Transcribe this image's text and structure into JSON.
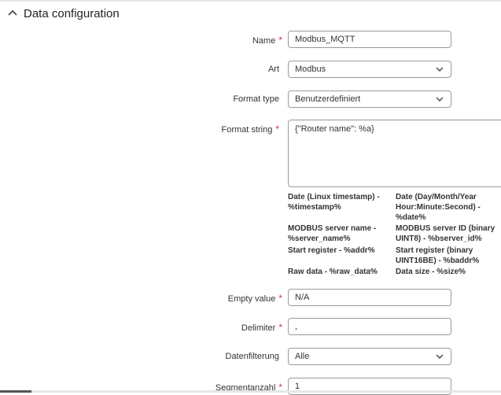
{
  "section": {
    "title": "Data configuration",
    "collapse_icon": "chevron-up-icon"
  },
  "fields": {
    "name": {
      "label": "Name",
      "value": "Modbus_MQTT",
      "required": "*"
    },
    "art": {
      "label": "Art",
      "value": "Modbus"
    },
    "format_type": {
      "label": "Format type",
      "value": "Benutzerdefiniert"
    },
    "format_string": {
      "label": "Format string",
      "value": "{\"Router name\": %a}",
      "required": "*"
    },
    "empty_value": {
      "label": "Empty value",
      "value": "N/A",
      "required": "*"
    },
    "delimiter": {
      "label": "Delimiter",
      "value": ",",
      "required": "*"
    },
    "datenfilterung": {
      "label": "Datenfilterung",
      "value": "Alle"
    },
    "segmentanzahl": {
      "label": "Segmentanzahl",
      "value": "1",
      "required": "*"
    }
  },
  "placeholders": [
    [
      "Date (Linux timestamp) -",
      "%timestamp%"
    ],
    [
      "Date (Day/Month/Year",
      "Hour:Minute:Second) -",
      "%date%"
    ],
    [
      "MODBUS server name -",
      "%server_name%"
    ],
    [
      "MODBUS server ID (binary",
      "UINT8) - %bserver_id%"
    ],
    [
      "Start register - %addr%"
    ],
    [
      "Start register (binary",
      "UINT16BE) - %baddr%"
    ],
    [
      "Raw data - %raw_data%"
    ],
    [
      "Data size - %size%"
    ]
  ],
  "colors": {
    "required": "#e0303a",
    "border": "#9a9a9a"
  }
}
